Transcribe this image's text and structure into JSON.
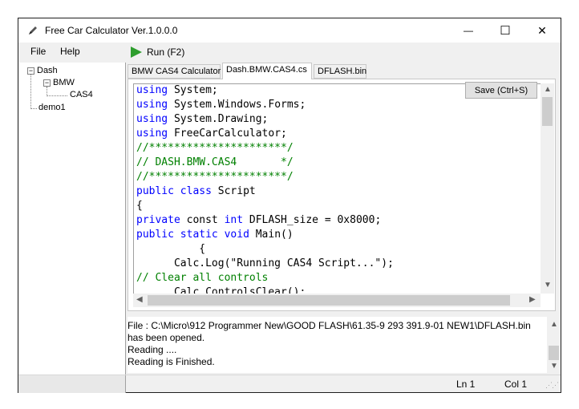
{
  "window": {
    "title": "Free Car Calculator Ver.1.0.0.0"
  },
  "titlebar": {
    "minimize": "—",
    "maximize": "☐",
    "close": "✕"
  },
  "menu": {
    "items": [
      "File",
      "Help"
    ]
  },
  "toolbar": {
    "run_label": "Run  (F2)"
  },
  "tree": {
    "nodes": [
      "Dash",
      "BMW",
      "CAS4",
      "demo1"
    ],
    "expander_minus": "−"
  },
  "tabs": [
    "BMW CAS4 Calculator",
    "Dash.BMW.CAS4.cs",
    "DFLASH.bin"
  ],
  "editor": {
    "save_label": "Save  (Ctrl+S)",
    "lines": [
      [
        {
          "t": "using",
          "c": "kw"
        },
        {
          "t": " System;",
          "c": ""
        }
      ],
      [
        {
          "t": "using",
          "c": "kw"
        },
        {
          "t": " System.Windows.Forms;",
          "c": ""
        }
      ],
      [
        {
          "t": "using",
          "c": "kw"
        },
        {
          "t": " System.Drawing;",
          "c": ""
        }
      ],
      [
        {
          "t": "using",
          "c": "kw"
        },
        {
          "t": " FreeCarCalculator;",
          "c": ""
        }
      ],
      [
        {
          "t": "//**********************/",
          "c": "cm"
        }
      ],
      [
        {
          "t": "// DASH.BMW.CAS4       */",
          "c": "cm"
        }
      ],
      [
        {
          "t": "//**********************/",
          "c": "cm"
        }
      ],
      [
        {
          "t": "public",
          "c": "kw"
        },
        {
          "t": " ",
          "c": ""
        },
        {
          "t": "class",
          "c": "kw"
        },
        {
          "t": " Script",
          "c": ""
        }
      ],
      [
        {
          "t": "{",
          "c": ""
        }
      ],
      [
        {
          "t": "private",
          "c": "kw"
        },
        {
          "t": " const ",
          "c": ""
        },
        {
          "t": "int",
          "c": "kw"
        },
        {
          "t": " DFLASH_size = 0x8000;",
          "c": ""
        }
      ],
      [
        {
          "t": "public",
          "c": "kw"
        },
        {
          "t": " ",
          "c": ""
        },
        {
          "t": "static",
          "c": "kw"
        },
        {
          "t": " ",
          "c": ""
        },
        {
          "t": "void",
          "c": "kw"
        },
        {
          "t": " Main()",
          "c": ""
        }
      ],
      [
        {
          "t": "          {",
          "c": ""
        }
      ],
      [
        {
          "t": "      Calc.Log(\"Running CAS4 Script...\");",
          "c": ""
        }
      ],
      [
        {
          "t": "// Clear all controls",
          "c": "cm"
        }
      ],
      [
        {
          "t": "      Calc.ControlsClear();",
          "c": ""
        }
      ]
    ]
  },
  "log": {
    "lines": [
      "File : C:\\Micro\\912 Programmer New\\GOOD FLASH\\61.35-9 293 391.9-01 NEW1\\DFLASH.bin",
      "has been opened.",
      "Reading ....",
      "Reading is Finished."
    ]
  },
  "status": {
    "ln": "Ln 1",
    "col": "Col 1"
  },
  "colors": {
    "keyword": "#0000ff",
    "comment": "#008000",
    "run_icon": "#2e9e2e"
  }
}
